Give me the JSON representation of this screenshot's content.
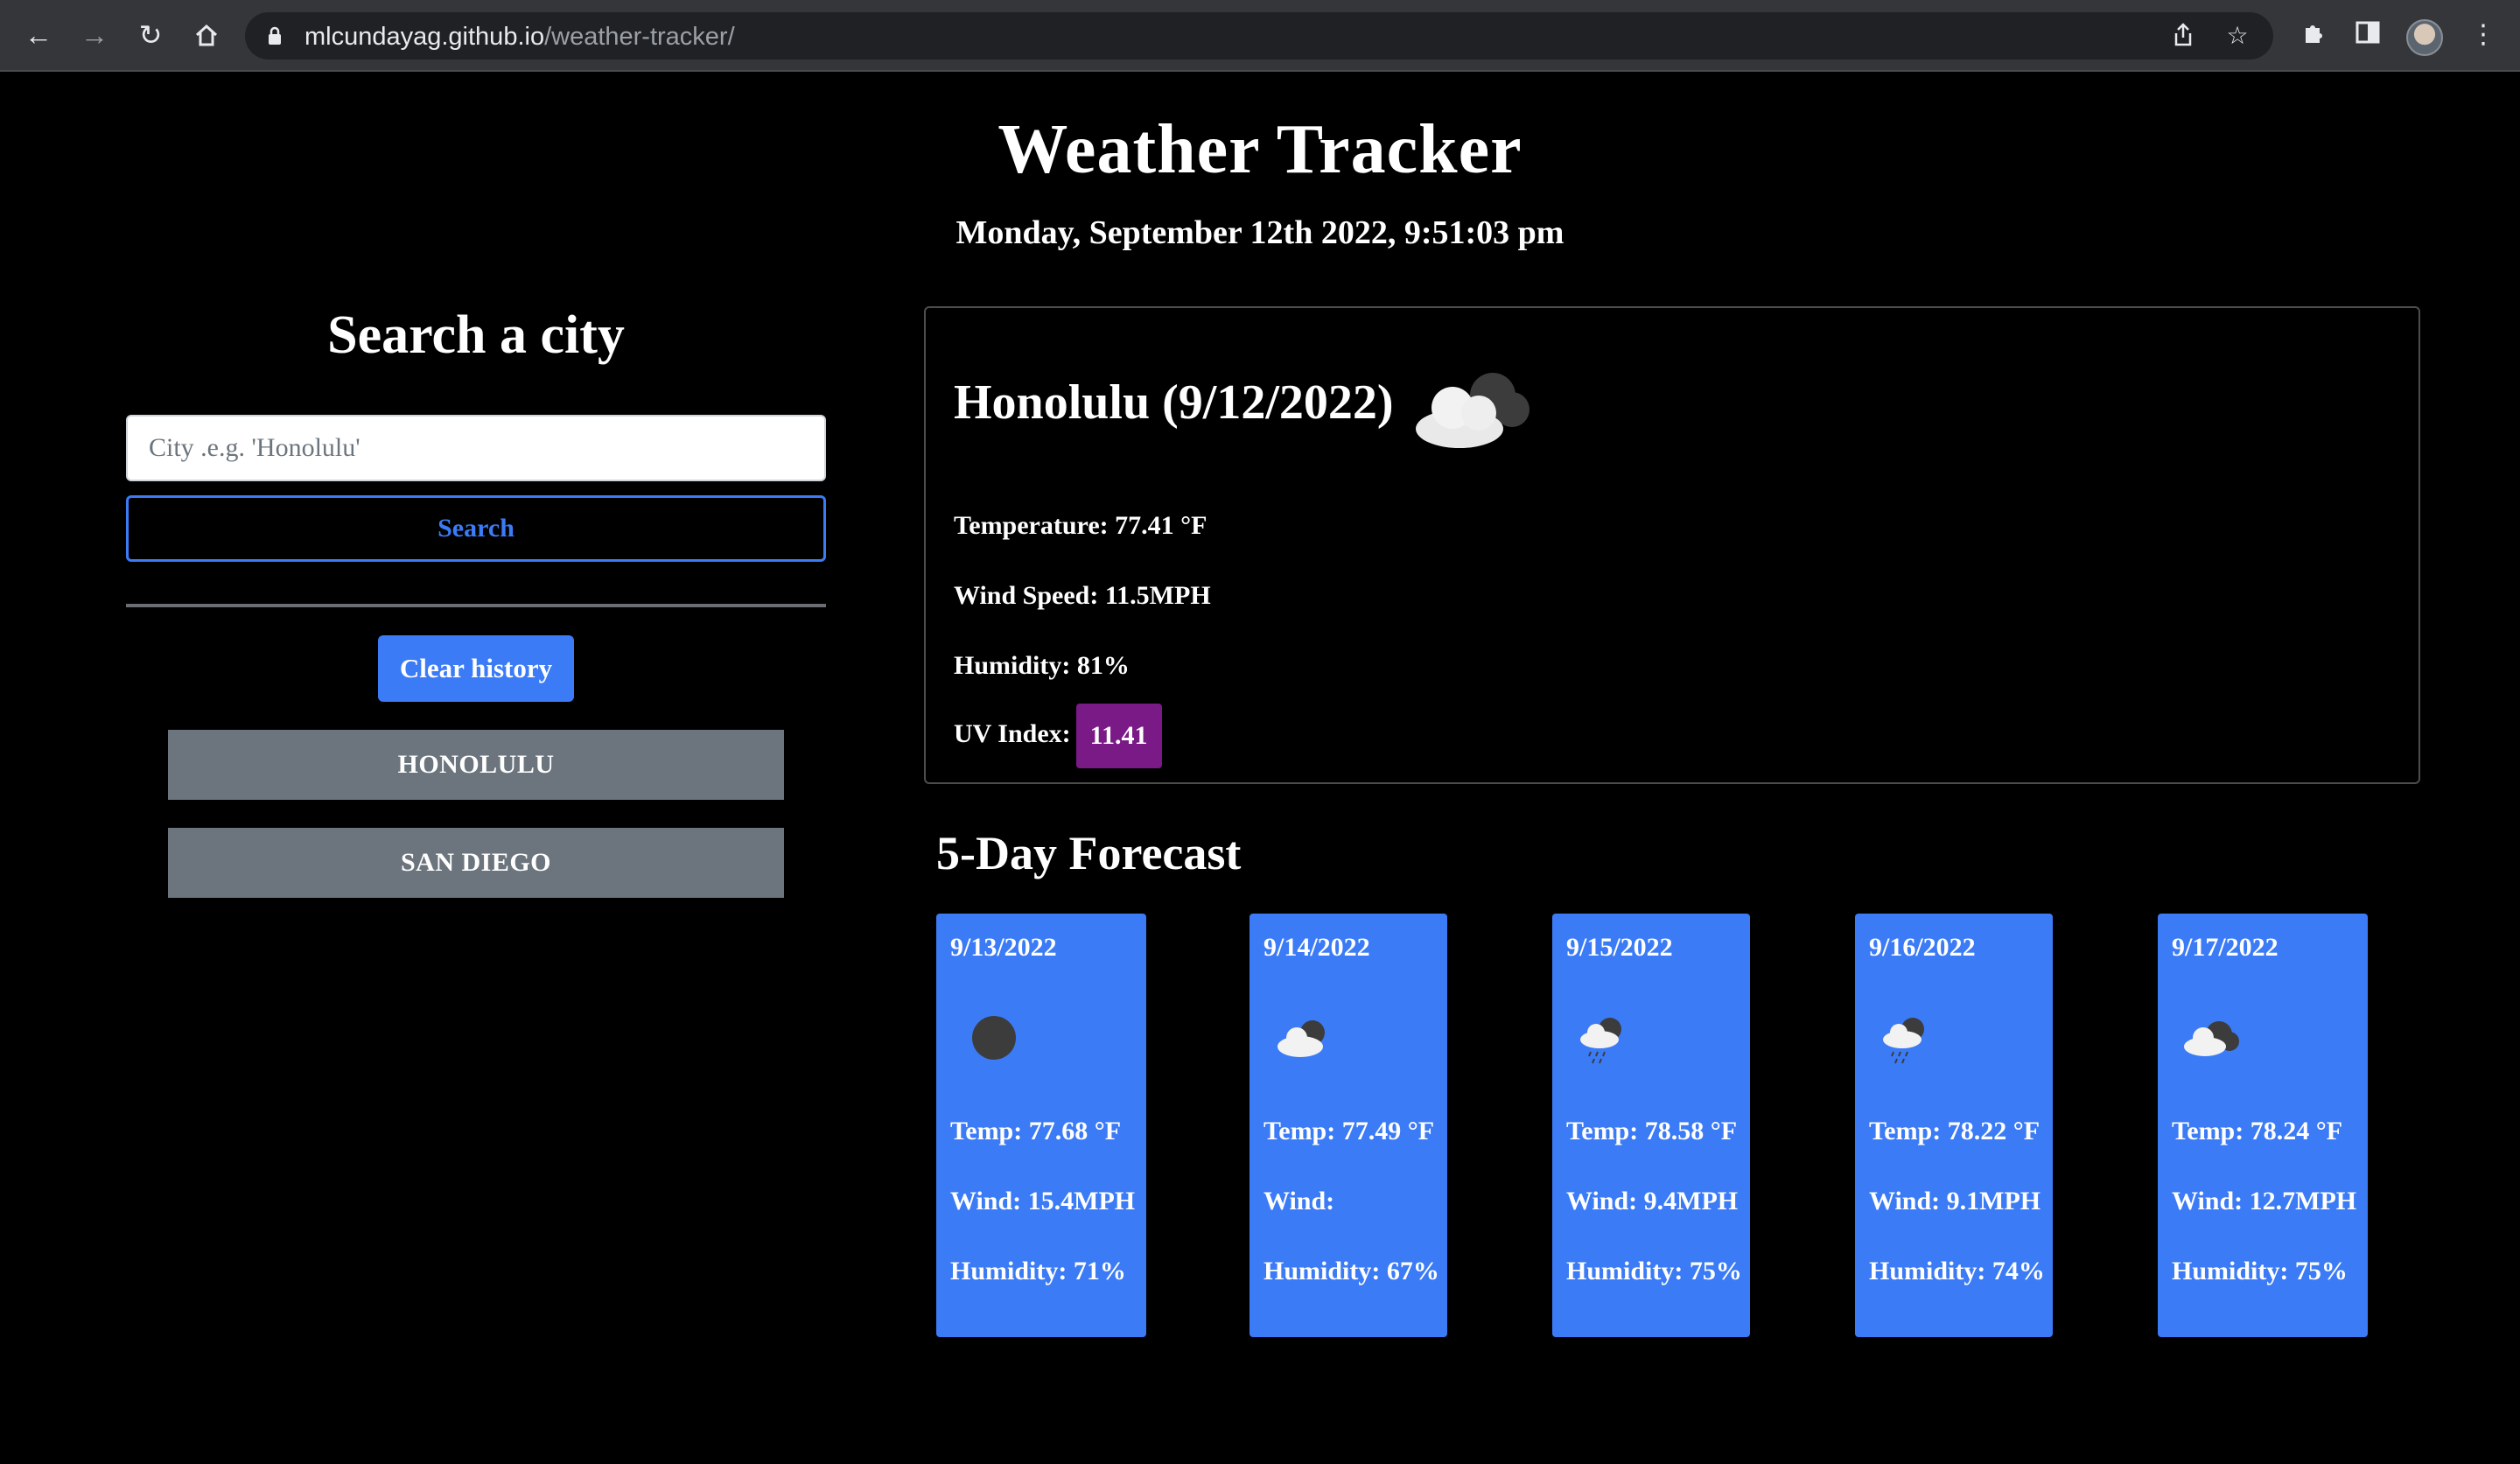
{
  "browser": {
    "url_host": "mlcundayag.github.io",
    "url_path": "/weather-tracker/"
  },
  "page": {
    "title": "Weather Tracker",
    "datetime": "Monday, September 12th 2022, 9:51:03 pm"
  },
  "search": {
    "heading": "Search a city",
    "placeholder": "City .e.g. 'Honolulu'",
    "button_label": "Search",
    "clear_label": "Clear history",
    "history": [
      "HONOLULU",
      "SAN DIEGO"
    ]
  },
  "current": {
    "city_date": "Honolulu (9/12/2022)",
    "icon": "cloud-icon",
    "temperature": "Temperature: 77.41 °F",
    "wind": "Wind Speed: 11.5MPH",
    "humidity": "Humidity: 81%",
    "uv_label": "UV Index:",
    "uv_value": "11.41",
    "uv_color": "#7a1a86"
  },
  "forecast": {
    "heading": "5-Day Forecast",
    "days": [
      {
        "date": "9/13/2022",
        "icon": "overcast-icon",
        "temp": "Temp: 77.68 °F",
        "wind": "Wind: 15.4MPH",
        "humidity": "Humidity: 71%"
      },
      {
        "date": "9/14/2022",
        "icon": "partly-cloudy-icon",
        "temp": "Temp: 77.49 °F",
        "wind": "Wind:",
        "humidity": "Humidity: 67%"
      },
      {
        "date": "9/15/2022",
        "icon": "rain-icon",
        "temp": "Temp: 78.58 °F",
        "wind": "Wind: 9.4MPH",
        "humidity": "Humidity: 75%"
      },
      {
        "date": "9/16/2022",
        "icon": "rain-icon",
        "temp": "Temp: 78.22 °F",
        "wind": "Wind: 9.1MPH",
        "humidity": "Humidity: 74%"
      },
      {
        "date": "9/17/2022",
        "icon": "broken-clouds-icon",
        "temp": "Temp: 78.24 °F",
        "wind": "Wind: 12.7MPH",
        "humidity": "Humidity: 75%"
      }
    ],
    "card_color": "#3b7bf6"
  }
}
